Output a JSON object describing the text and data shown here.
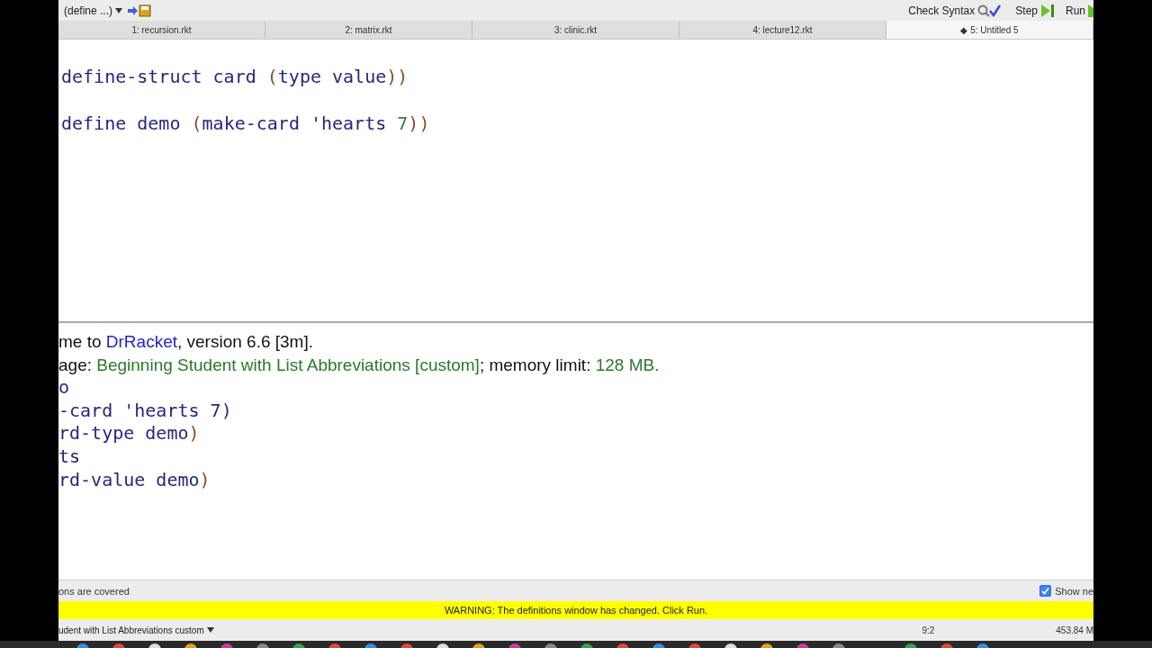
{
  "toolbar": {
    "definitions_menu": "(define ...)",
    "check_syntax": "Check Syntax",
    "step": "Step",
    "run": "Run"
  },
  "tabs": [
    {
      "label": "1: recursion.rkt",
      "selected": false
    },
    {
      "label": "2: matrix.rkt",
      "selected": false
    },
    {
      "label": "3: clinic.rkt",
      "selected": false
    },
    {
      "label": "4: lecture12.rkt",
      "selected": false
    },
    {
      "label": "◆ 5: Untitled 5",
      "selected": true
    }
  ],
  "definitions": [
    [
      {
        "kind": "ident",
        "text": "define-struct card "
      },
      {
        "kind": "paren",
        "text": "("
      },
      {
        "kind": "ident",
        "text": "type value"
      },
      {
        "kind": "paren",
        "text": "))"
      }
    ],
    [
      {
        "kind": "ident",
        "text": "define demo "
      },
      {
        "kind": "paren",
        "text": "("
      },
      {
        "kind": "ident",
        "text": "make-card 'hearts "
      },
      {
        "kind": "number",
        "text": "7"
      },
      {
        "kind": "paren",
        "text": "))"
      }
    ]
  ],
  "interactions": [
    [
      {
        "kind": "plain",
        "text": "me to "
      },
      {
        "kind": "link",
        "text": "DrRacket"
      },
      {
        "kind": "plain",
        "text": ", version 6.6 [3m]."
      }
    ],
    [
      {
        "kind": "plain",
        "text": "age: "
      },
      {
        "kind": "green",
        "text": "Beginning Student with List Abbreviations [custom]"
      },
      {
        "kind": "plain",
        "text": "; memory limit: "
      },
      {
        "kind": "green",
        "text": "128 MB."
      }
    ],
    [
      {
        "kind": "ident",
        "text": "o"
      }
    ],
    [
      {
        "kind": "ident",
        "text": "-card 'hearts 7"
      },
      {
        "kind": "ident",
        "text": ")"
      }
    ],
    [
      {
        "kind": "ident",
        "text": "rd-type demo"
      },
      {
        "kind": "paren",
        "text": ")"
      }
    ],
    [
      {
        "kind": "ident",
        "text": "ts"
      }
    ],
    [
      {
        "kind": "ident",
        "text": "rd-value demo"
      },
      {
        "kind": "paren",
        "text": ")"
      }
    ]
  ],
  "status": {
    "message": "ons are covered",
    "show_next": {
      "label": "Show ne",
      "checked": true
    }
  },
  "warning": "WARNING: The definitions window has changed. Click Run.",
  "bottom_bar": {
    "language": "udent with List Abbreviations custom",
    "position": "9:2",
    "memory": "453.84 M"
  }
}
